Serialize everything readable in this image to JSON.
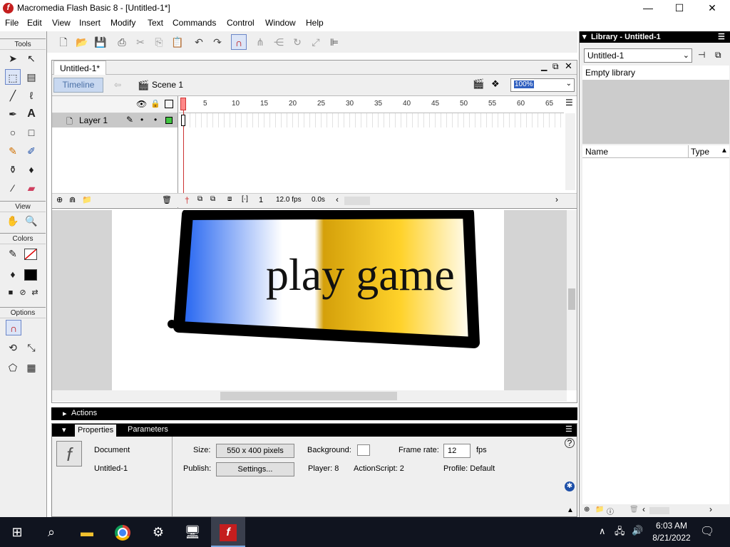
{
  "window": {
    "title": "Macromedia Flash Basic 8 - [Untitled-1*]",
    "logo_letter": "f",
    "min": "—",
    "max": "☐",
    "close": "✕"
  },
  "menu": [
    "File",
    "Edit",
    "View",
    "Insert",
    "Modify",
    "Text",
    "Commands",
    "Control",
    "Window",
    "Help"
  ],
  "toolbox": {
    "tools_label": "Tools",
    "view_label": "View",
    "colors_label": "Colors",
    "options_label": "Options"
  },
  "document": {
    "tab": "Untitled-1*",
    "timeline_button": "Timeline",
    "scene": "Scene 1",
    "zoom": "100%"
  },
  "timeline": {
    "layer_name": "Layer 1",
    "frame_ticks": [
      "1",
      "5",
      "10",
      "15",
      "20",
      "25",
      "30",
      "35",
      "40",
      "45",
      "50",
      "55",
      "60",
      "65"
    ],
    "current_frame": "1",
    "fps": "12.0 fps",
    "elapsed": "0.0s"
  },
  "stage": {
    "button_text": "play game"
  },
  "actions_panel": {
    "label": "Actions"
  },
  "properties": {
    "tab_properties": "Properties",
    "tab_parameters": "Parameters",
    "doc_type": "Document",
    "doc_name": "Untitled-1",
    "size_label": "Size:",
    "size_value": "550 x 400 pixels",
    "background_label": "Background:",
    "frame_rate_label": "Frame rate:",
    "frame_rate_value": "12",
    "fps_unit": "fps",
    "publish_label": "Publish:",
    "settings_button": "Settings...",
    "player": "Player: 8",
    "actionscript": "ActionScript: 2",
    "profile": "Profile: Default"
  },
  "library": {
    "header": "Library - Untitled-1",
    "dropdown": "Untitled-1",
    "empty": "Empty library",
    "col_name": "Name",
    "col_type": "Type"
  },
  "taskbar": {
    "time": "6:03 AM",
    "date": "8/21/2022"
  },
  "colors": {
    "accent": "#1e6fd8",
    "stage_bg": "#ffffff",
    "work_area": "#d4d4d4",
    "taskbar": "#10141f"
  }
}
